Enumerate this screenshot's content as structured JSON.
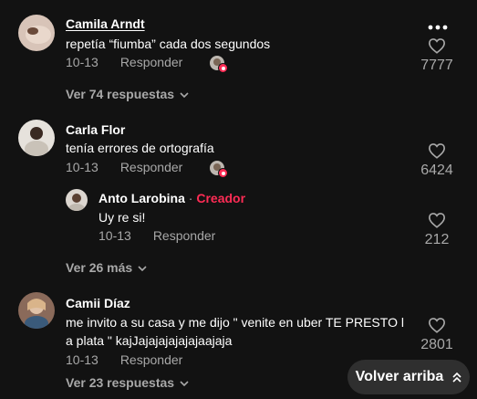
{
  "comments": [
    {
      "author": "Camila Arndt",
      "text": "repetía “fiumba” cada dos segundos",
      "date": "10-13",
      "reply_label": "Responder",
      "likes": "7777",
      "view_more": "Ver 74 respuestas",
      "avatar_color": "#cdb6a8"
    },
    {
      "author": "Carla Flor",
      "text": "tenía errores de ortografía",
      "date": "10-13",
      "reply_label": "Responder",
      "likes": "6424",
      "avatar_color": "#b7b3ae",
      "reply": {
        "author": "Anto Larobina",
        "separator": "·",
        "badge": "Creador",
        "text": "Uy re si!",
        "date": "10-13",
        "reply_label": "Responder",
        "likes": "212"
      },
      "view_more": "Ver 26 más"
    },
    {
      "author": "Camii Díaz",
      "text_line1": "me invito a su casa y me dijo \" venite en uber TE PRESTO l",
      "text_line2": "a plata \" kajJajajajajajajaajaja",
      "date": "10-13",
      "reply_label": "Responder",
      "likes": "2801",
      "view_more": "Ver 23 respuestas",
      "avatar_color": "#a08070"
    }
  ],
  "back_to_top": "Volver arriba",
  "colors": {
    "background": "#121212",
    "creator_accent": "#fe2c55",
    "muted": "#a8a8a8",
    "button_bg": "#2f2f2f"
  }
}
